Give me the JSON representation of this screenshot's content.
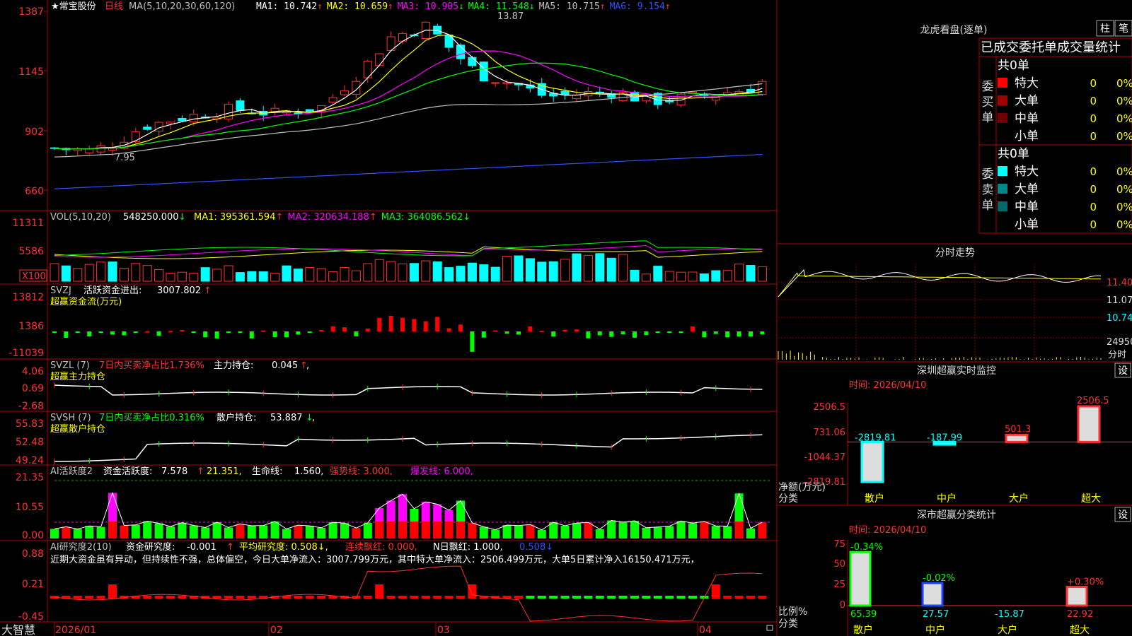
{
  "app": {
    "logo": "大智慧"
  },
  "main": {
    "stock_name": "★常宝股份",
    "period": "日线",
    "ma_params": "MA(5,10,20,30,60,120)",
    "ma": [
      {
        "label": "MA1:",
        "value": "10.742",
        "arrow": "↑",
        "color": "#ffffff"
      },
      {
        "label": "MA2:",
        "value": "10.659",
        "arrow": "↑",
        "color": "#ffff00"
      },
      {
        "label": "MA3:",
        "value": "10.905",
        "arrow": "↓",
        "color": "#ff00ff"
      },
      {
        "label": "MA4:",
        "value": "11.548",
        "arrow": "↓",
        "color": "#00ff00"
      },
      {
        "label": "MA5:",
        "value": "10.715",
        "arrow": "↑",
        "color": "#c0c0c0"
      },
      {
        "label": "MA6:",
        "value": "9.154",
        "arrow": "↑",
        "color": "#3050ff"
      }
    ],
    "y_ticks": [
      "1387",
      "1145",
      "902",
      "660"
    ],
    "high_label": "13.87",
    "low_label": "7.95"
  },
  "vol": {
    "header": "VOL(5,10,20)",
    "value": "548250.000",
    "arrow": "↓",
    "ma": [
      {
        "label": "MA1:",
        "value": "395361.594",
        "arrow": "↑",
        "color": "#ffff00"
      },
      {
        "label": "MA2:",
        "value": "320634.188",
        "arrow": "↑",
        "color": "#ff00ff"
      },
      {
        "label": "MA3:",
        "value": "364086.562",
        "arrow": "↓",
        "color": "#00ff00"
      }
    ],
    "y_ticks": [
      "11311",
      "5586"
    ],
    "unit": "X100"
  },
  "svzj": {
    "header": "SVZJ",
    "line_label": "活跃资金进出:",
    "value": "3007.802",
    "arrow": "↑",
    "subtitle": "超赢资金流(万元)",
    "y_ticks": [
      "13812",
      "1386",
      "-11039"
    ]
  },
  "svzl": {
    "header": "SVZL (7)",
    "desc": "7日内买卖净占比1.736%",
    "label": "主力持仓:",
    "value": "0.045",
    "arrow": "↑",
    "suffix": ",",
    "subtitle": "超赢主力持仓",
    "y_ticks": [
      "4.06",
      "0.69",
      "-2.68"
    ]
  },
  "svsh": {
    "header": "SVSH (7)",
    "desc": "7日内买卖净占比0.316%",
    "label": "散户持仓:",
    "value": "53.887",
    "arrow": "↓",
    "suffix": ",",
    "subtitle": "超赢散户持仓",
    "y_ticks": [
      "55.83",
      "52.48",
      "49.24"
    ]
  },
  "ai1": {
    "header": "AI活跃度2",
    "label": "资金活跃度:",
    "value": "7.578",
    "arrow": "↑",
    "v2": "21.351,",
    "life_label": "生命线:",
    "life": "1.560,",
    "strong": "强势线: 3.000,",
    "burst": "爆发线: 6.000,",
    "y_ticks": [
      "21.35",
      "10.55",
      "0.00"
    ]
  },
  "ai2": {
    "header": "AI研究度2(10)",
    "label": "资金研究度:",
    "value": "-0.001",
    "arrow": "↑",
    "avg": "平均研究度: 0.508↓,",
    "streak": "连续飘红: 0.000,",
    "nday": "N日飘红: 1.000,",
    "last": "0.508↓",
    "comment": "近期大资金虽有异动，但持续性不强，总体偏空，今日大单净流入：3007.799万元，其中特大单净流入：2506.499万元，大单5日累计净入16150.471万元，",
    "y_ticks": [
      "0.88",
      "0.21",
      "-0.45"
    ]
  },
  "xaxis": {
    "labels": [
      "2026/01",
      "02",
      "03",
      "04"
    ]
  },
  "dragon": {
    "title": "龙虎看盘(逐单)",
    "btn1": "柱",
    "btn2": "笔",
    "subtitle": "已成交委托单成交量统计",
    "buy_group": "委买单",
    "sell_group": "委卖单",
    "buy_total": "共0单",
    "sell_total": "共0单",
    "buy_rows": [
      {
        "label": "特大",
        "count": "0",
        "pct": "0%",
        "color": "#ff0000"
      },
      {
        "label": "大单",
        "count": "0",
        "pct": "0%",
        "color": "#a00000"
      },
      {
        "label": "中单",
        "count": "0",
        "pct": "0%",
        "color": "#700000"
      },
      {
        "label": "小单",
        "count": "0",
        "pct": "0%",
        "color": ""
      }
    ],
    "sell_rows": [
      {
        "label": "特大",
        "count": "0",
        "pct": "0%",
        "color": "#00ffff"
      },
      {
        "label": "大单",
        "count": "0",
        "pct": "0%",
        "color": "#008888"
      },
      {
        "label": "中单",
        "count": "0",
        "pct": "0%",
        "color": "#006868"
      },
      {
        "label": "小单",
        "count": "0",
        "pct": "0%",
        "color": ""
      }
    ]
  },
  "intraday": {
    "title": "分时走势",
    "price_ticks": [
      "11.40",
      "11.07",
      "10.74"
    ],
    "volume_tick": "24950",
    "unit_label": "分时"
  },
  "monitor": {
    "title": "深圳超赢实时监控",
    "set_button": "设",
    "time_label": "时间: 2026/04/10",
    "y_ticks": [
      "2506.5",
      "731.06",
      "-1044.37",
      "-2819.81"
    ],
    "y_caption1": "净额(万元)",
    "y_caption2": "分类"
  },
  "classify": {
    "title": "深市超赢分类统计",
    "set_button": "设",
    "time_label": "时间: 2026/04/10",
    "y_ticks": [
      "75",
      "50",
      "25",
      "0"
    ],
    "y_caption1": "比例%",
    "y_caption2": "分类"
  },
  "chart_data": [
    {
      "type": "bar",
      "title": "深圳超赢实时监控",
      "ylabel": "净额(万元)",
      "categories": [
        "散户",
        "中户",
        "大户",
        "超大"
      ],
      "values": [
        -2819.81,
        -187.99,
        501.3,
        2506.5
      ],
      "value_labels": [
        "-2819.81",
        "-187.99",
        "501.3",
        "2506.5"
      ],
      "ylim": [
        -2819.81,
        2506.5
      ]
    },
    {
      "type": "bar",
      "title": "深市超赢分类统计",
      "ylabel": "比例%",
      "categories": [
        "散户",
        "中户",
        "大户",
        "超大"
      ],
      "values": [
        65.39,
        27.57,
        -15.87,
        22.92
      ],
      "change_labels": [
        "-0.34%",
        "-0.02%",
        "",
        "+0.30%"
      ],
      "value_labels": [
        "65.39",
        "27.57",
        "-15.87",
        "22.92"
      ],
      "ylim": [
        0,
        75
      ]
    }
  ]
}
